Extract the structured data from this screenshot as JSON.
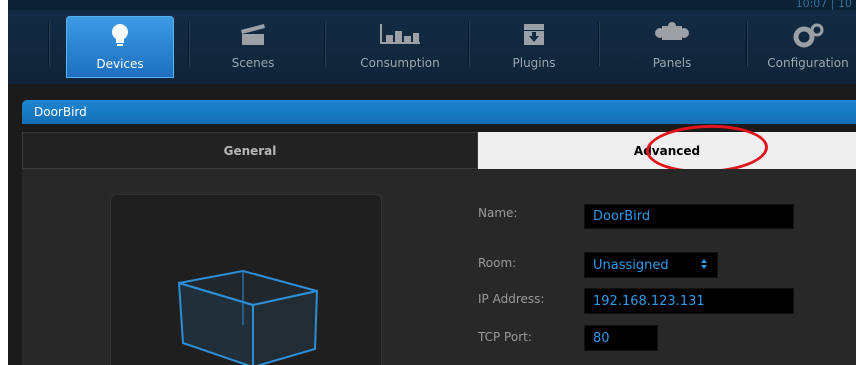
{
  "topbar": {
    "clock": "10:07 | 10",
    "nav_items": [
      {
        "label": "Devices",
        "icon": "lightbulb-icon"
      },
      {
        "label": "Scenes",
        "icon": "clapperboard-icon"
      },
      {
        "label": "Consumption",
        "icon": "bar-chart-icon"
      },
      {
        "label": "Plugins",
        "icon": "plugin-box-icon"
      },
      {
        "label": "Panels",
        "icon": "puzzle-icon"
      },
      {
        "label": "Configuration",
        "icon": "gears-icon"
      }
    ],
    "active_item": "Devices",
    "accent_color": "#2a86d6"
  },
  "panel": {
    "title": "DoorBird",
    "tabs": [
      {
        "label": "General",
        "selected": false
      },
      {
        "label": "Advanced",
        "selected": true
      }
    ],
    "annotation_color": "#e2141d"
  },
  "form": {
    "name_label": "Name:",
    "name_value": "DoorBird",
    "room_label": "Room:",
    "room_value": "Unassigned",
    "ip_label": "IP Address:",
    "ip_value": "192.168.123.131",
    "port_label": "TCP Port:",
    "port_value": "80"
  },
  "preview": {
    "icon": "cube-device-icon"
  }
}
